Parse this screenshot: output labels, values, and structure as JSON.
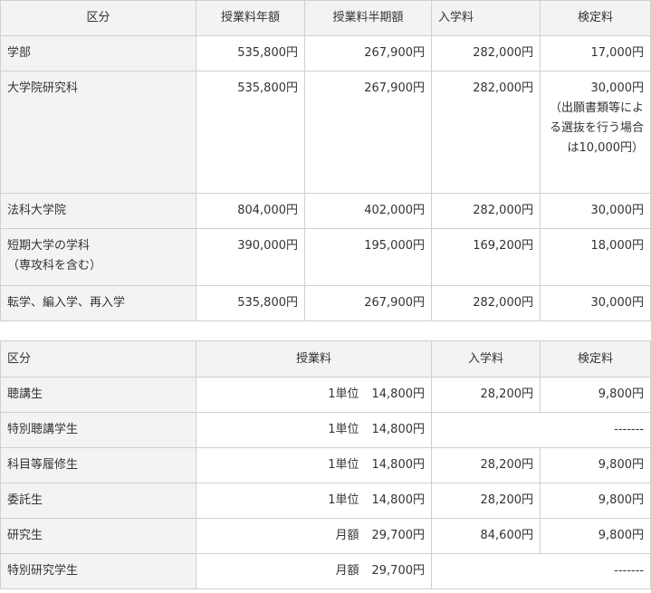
{
  "fees_table": {
    "headers": [
      "区分",
      "授業料年額",
      "授業料半期額",
      "入学料",
      "検定料"
    ],
    "rows": [
      {
        "category": "学部",
        "annual": "535,800円",
        "half": "267,900円",
        "admission": "282,000円",
        "exam": "17,000円"
      },
      {
        "category": "大学院研究科",
        "annual": "535,800円",
        "half": "267,900円",
        "admission": "282,000円",
        "exam": "30,000円",
        "exam_note": "（出願書類等による選抜を行う場合は10,000円）"
      },
      {
        "category": "法科大学院",
        "annual": "804,000円",
        "half": "402,000円",
        "admission": "282,000円",
        "exam": "30,000円"
      },
      {
        "category": "短期大学の学科",
        "category_note": "（専攻科を含む）",
        "annual": "390,000円",
        "half": "195,000円",
        "admission": "169,200円",
        "exam": "18,000円"
      },
      {
        "category": "転学、編入学、再入学",
        "annual": "535,800円",
        "half": "267,900円",
        "admission": "282,000円",
        "exam": "30,000円"
      }
    ]
  },
  "auditor_table": {
    "headers": [
      "区分",
      "授業料",
      "入学料",
      "検定料"
    ],
    "rows": [
      {
        "category": "聴講生",
        "unit": "1単位",
        "fee": "14,800円",
        "admission": "28,200円",
        "exam": "9,800円"
      },
      {
        "category": "特別聴講学生",
        "unit": "1単位",
        "fee": "14,800円",
        "merged": "-------"
      },
      {
        "category": "科目等履修生",
        "unit": "1単位",
        "fee": "14,800円",
        "admission": "28,200円",
        "exam": "9,800円"
      },
      {
        "category": "委託生",
        "unit": "1単位",
        "fee": "14,800円",
        "admission": "28,200円",
        "exam": "9,800円"
      },
      {
        "category": "研究生",
        "unit": "月額",
        "fee": "29,700円",
        "admission": "84,600円",
        "exam": "9,800円"
      },
      {
        "category": "特別研究学生",
        "unit": "月額",
        "fee": "29,700円",
        "merged": "-------"
      }
    ]
  }
}
